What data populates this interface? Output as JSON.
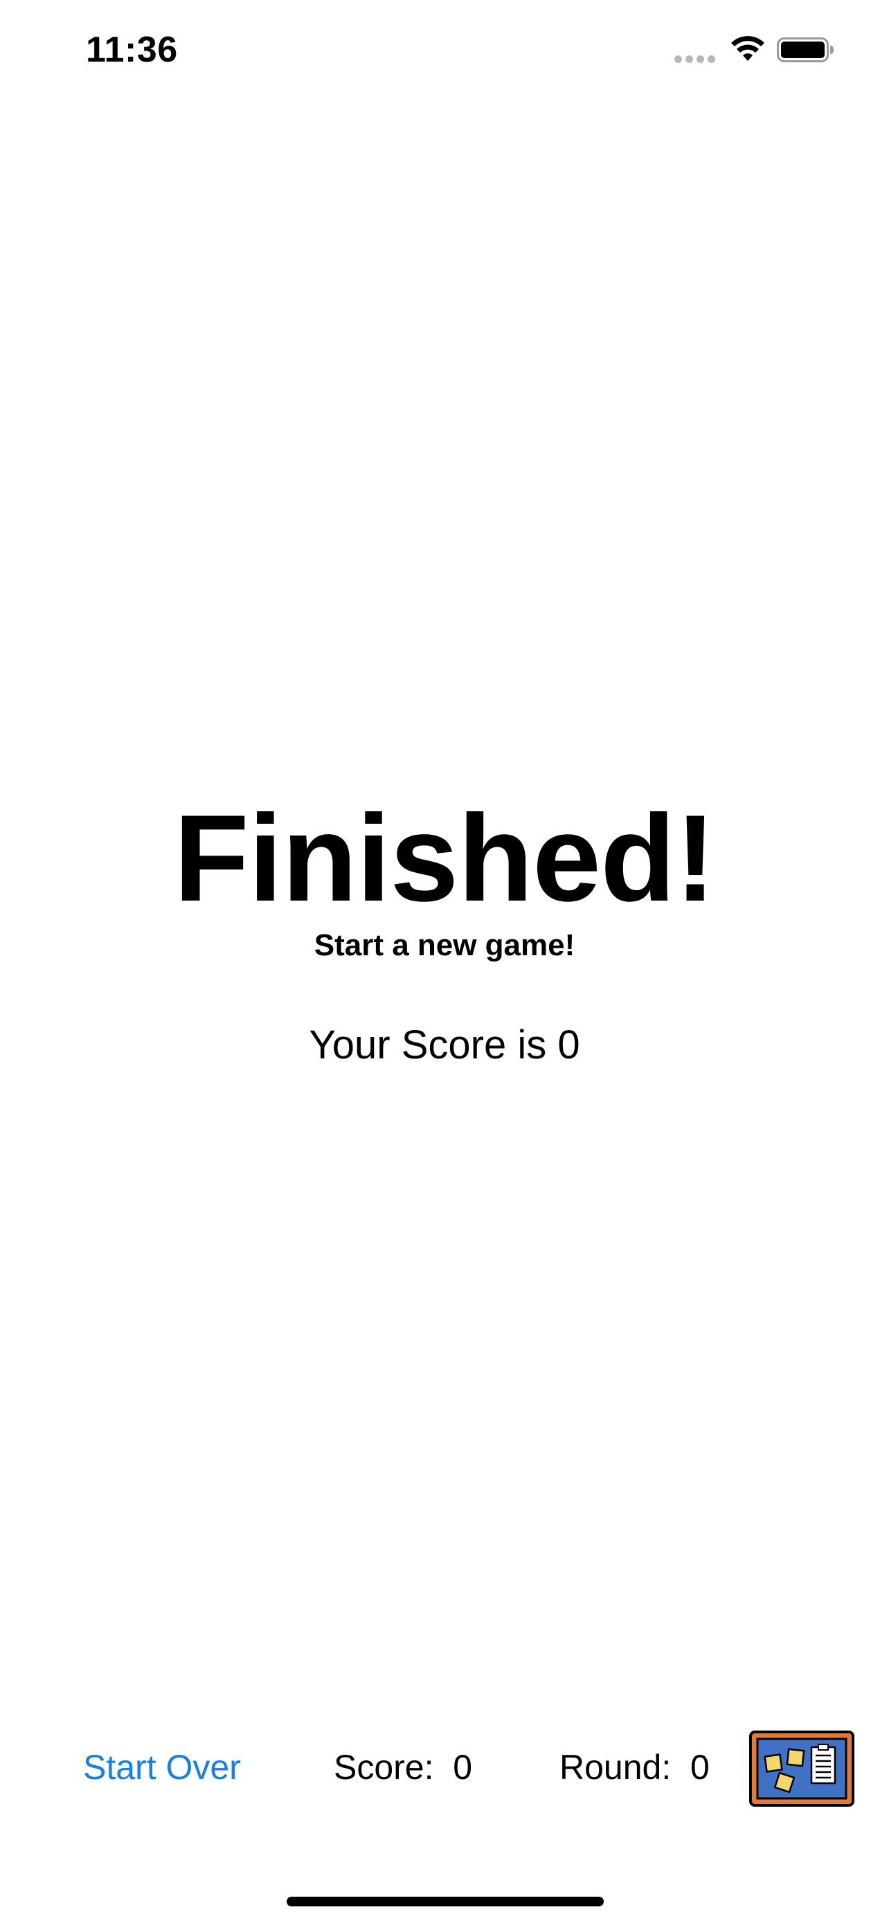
{
  "status_bar": {
    "time": "11:36",
    "icons": [
      "cellular-signal-icon",
      "wifi-icon",
      "battery-icon"
    ]
  },
  "main": {
    "title": "Finished!",
    "subtitle": "Start a new game!",
    "score_text": "Your Score is 0"
  },
  "toolbar": {
    "start_over_label": "Start Over",
    "score_label": "Score:  0",
    "round_label": "Round:  0",
    "board_icon": "bulletin-board-icon"
  },
  "colors": {
    "accent": "#1a7ee8",
    "board_frame": "#e07b35",
    "board_fill": "#3f72c4",
    "note_yellow": "#f5d66b"
  }
}
